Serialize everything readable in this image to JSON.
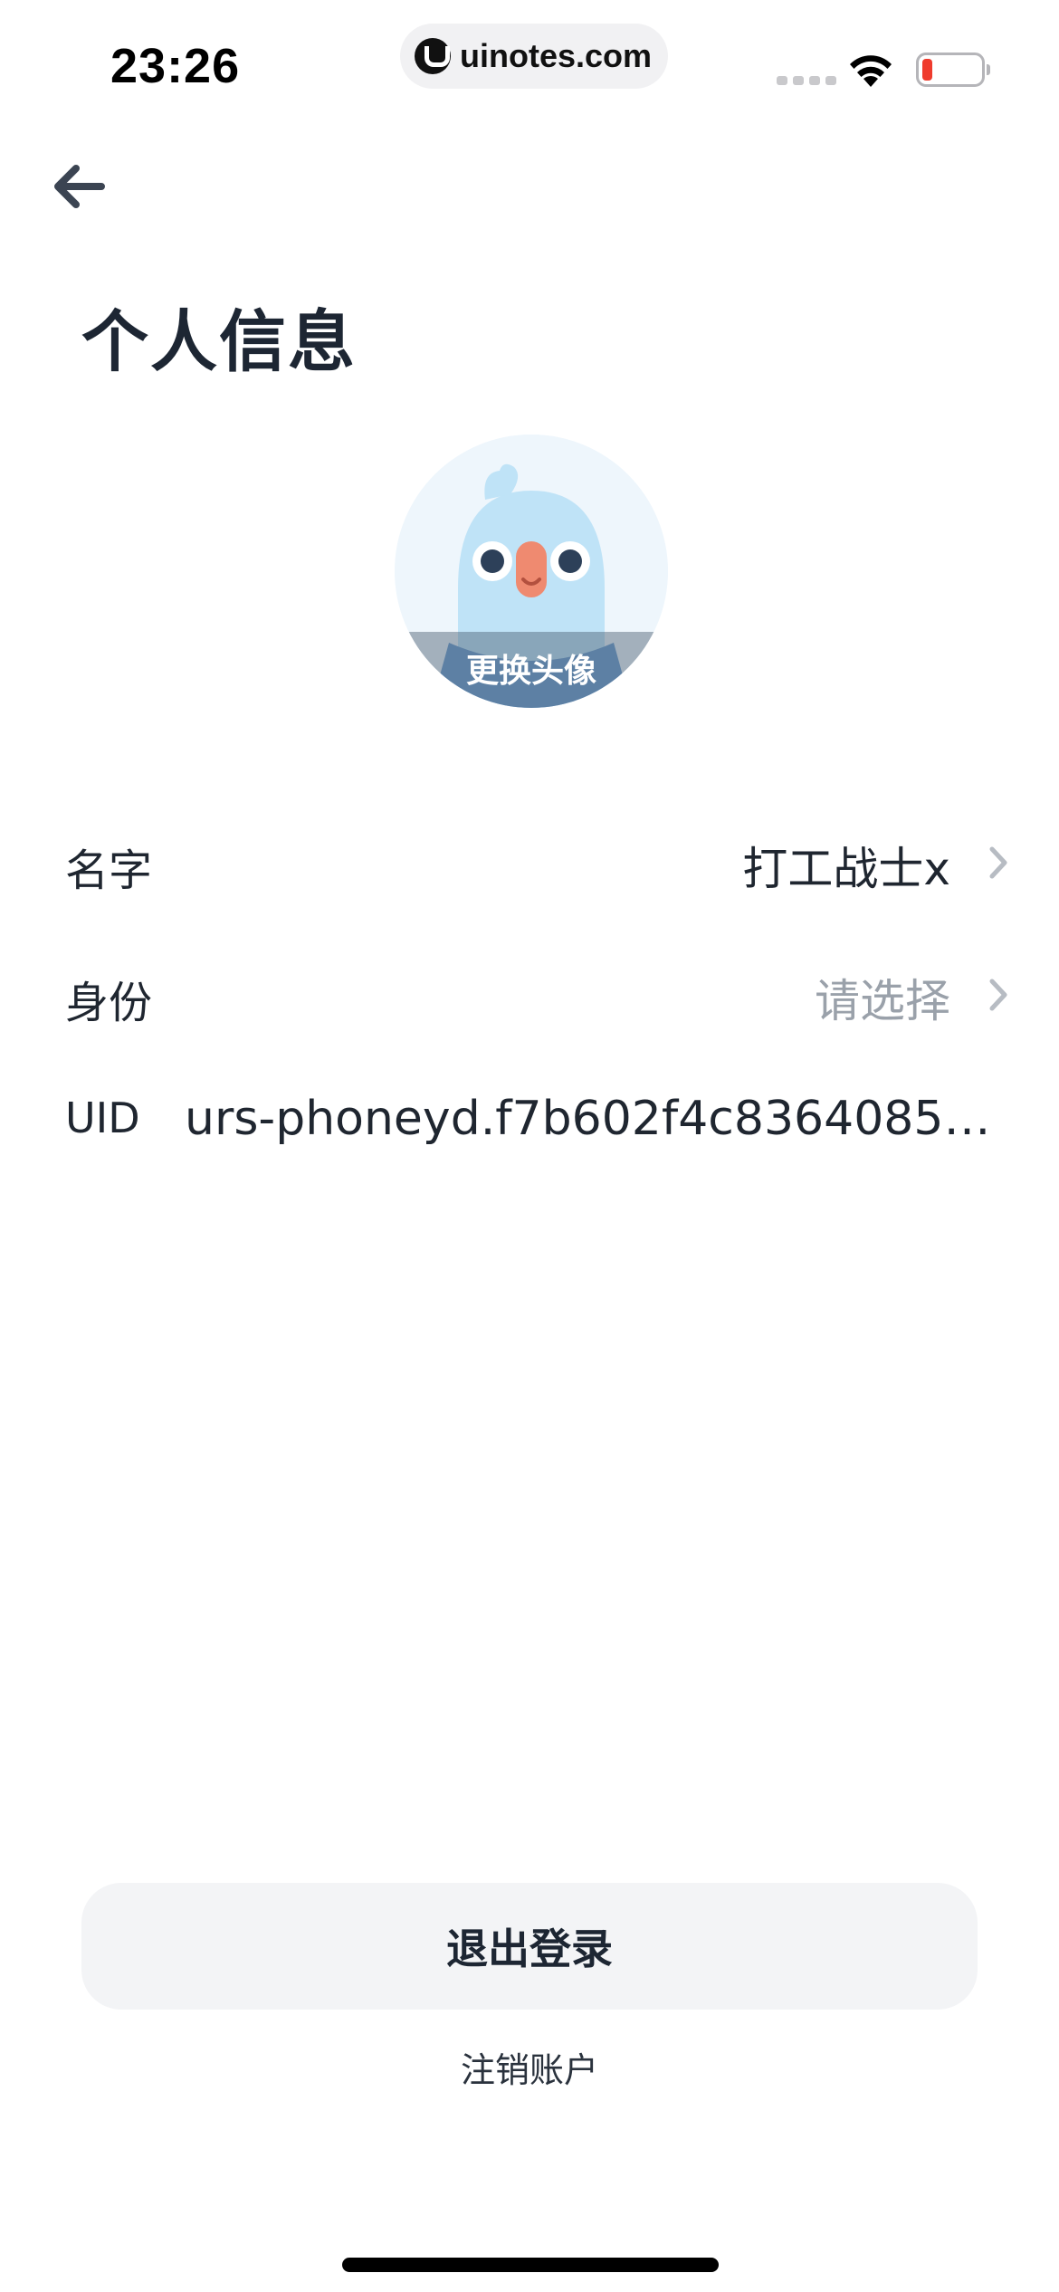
{
  "status_bar": {
    "time": "23:26",
    "url": "uinotes.com",
    "icons": [
      "signal-dots-icon",
      "wifi-icon",
      "battery-low-icon"
    ],
    "battery_color": "#ef3b2d"
  },
  "header": {
    "back_icon": "arrow-left-icon",
    "title": "个人信息"
  },
  "avatar": {
    "change_label": "更换头像"
  },
  "profile": {
    "name": {
      "label": "名字",
      "value": "打工战士x"
    },
    "identity": {
      "label": "身份",
      "placeholder": "请选择"
    },
    "uid": {
      "label": "UID",
      "value": "urs-phoneyd.f7b602f4c83640859…"
    }
  },
  "actions": {
    "logout_label": "退出登录",
    "cancel_account_label": "注销账户"
  },
  "colors": {
    "title_text": "#1d2633",
    "placeholder_text": "#9aa1aa",
    "button_bg": "#f3f4f6",
    "chevron": "#b7bcc3"
  }
}
